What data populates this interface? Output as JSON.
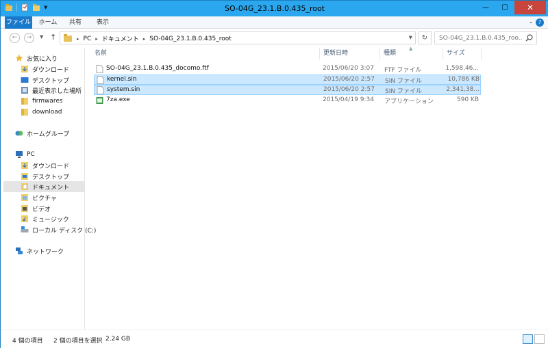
{
  "window": {
    "title": "SO-04G_23.1.B.0.435_root"
  },
  "window_controls": {
    "minimize": "—",
    "maximize": "☐",
    "close": "✕"
  },
  "ribbon": {
    "tabs": [
      {
        "label": "ファイル"
      },
      {
        "label": "ホーム"
      },
      {
        "label": "共有"
      },
      {
        "label": "表示"
      }
    ],
    "help": "?"
  },
  "address": {
    "crumbs": [
      "PC",
      "ドキュメント",
      "SO-04G_23.1.B.0.435_root"
    ],
    "search_placeholder": "SO-04G_23.1.B.0.435_roo..."
  },
  "sidebar": {
    "favorites_label": "お気に入り",
    "favorites": [
      {
        "label": "ダウンロード"
      },
      {
        "label": "デスクトップ"
      },
      {
        "label": "最近表示した場所"
      },
      {
        "label": "firmwares"
      },
      {
        "label": "download"
      }
    ],
    "homegroup_label": "ホームグループ",
    "pc_label": "PC",
    "pc_items": [
      {
        "label": "ダウンロード"
      },
      {
        "label": "デスクトップ"
      },
      {
        "label": "ドキュメント"
      },
      {
        "label": "ピクチャ"
      },
      {
        "label": "ビデオ"
      },
      {
        "label": "ミュージック"
      },
      {
        "label": "ローカル ディスク (C:)"
      }
    ],
    "network_label": "ネットワーク"
  },
  "columns": {
    "name": "名前",
    "date": "更新日時",
    "type": "種類",
    "size": "サイズ"
  },
  "files": [
    {
      "name": "SO-04G_23.1.B.0.435_docomo.ftf",
      "date": "2015/06/20 3:07",
      "type": "FTF ファイル",
      "size": "1,598,46...",
      "selected": false
    },
    {
      "name": "kernel.sin",
      "date": "2015/06/20 2:57",
      "type": "SIN ファイル",
      "size": "10,786 KB",
      "selected": true
    },
    {
      "name": "system.sin",
      "date": "2015/06/20 2:57",
      "type": "SIN ファイル",
      "size": "2,341,38...",
      "selected": true
    },
    {
      "name": "7za.exe",
      "date": "2015/04/19 9:34",
      "type": "アプリケーション",
      "size": "590 KB",
      "selected": false
    }
  ],
  "status": {
    "count": "4 個の項目",
    "selection": "2 個の項目を選択",
    "selection_size": "2.24 GB"
  }
}
